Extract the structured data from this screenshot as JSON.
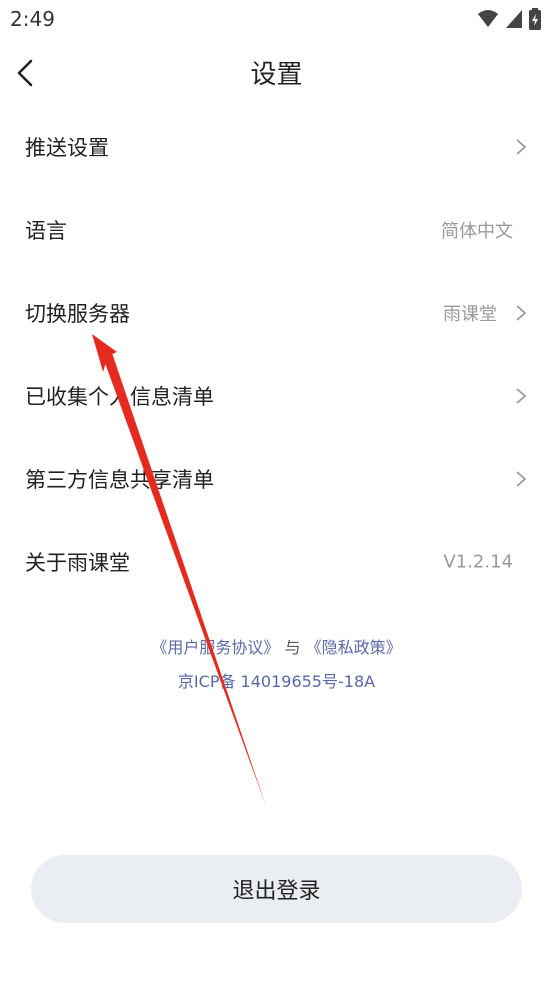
{
  "status_bar": {
    "time": "2:49"
  },
  "nav": {
    "title": "设置"
  },
  "settings": [
    {
      "label": "推送设置",
      "value": "",
      "chevron": true
    },
    {
      "label": "语言",
      "value": "简体中文",
      "chevron": false
    },
    {
      "label": "切换服务器",
      "value": "雨课堂",
      "chevron": true
    },
    {
      "label": "已收集个人信息清单",
      "value": "",
      "chevron": true
    },
    {
      "label": "第三方信息共享清单",
      "value": "",
      "chevron": true
    },
    {
      "label": "关于雨课堂",
      "value": "V1.2.14",
      "chevron": false
    }
  ],
  "links": {
    "user_agreement": "《用户服务协议》",
    "conjunction": "与",
    "privacy_policy": "《隐私政策》",
    "icp": "京ICP备 14019655号-18A"
  },
  "logout_label": "退出登录",
  "colors": {
    "arrow": "#e52b20",
    "link": "#5a6aa6",
    "button_bg": "#eaedf1"
  }
}
